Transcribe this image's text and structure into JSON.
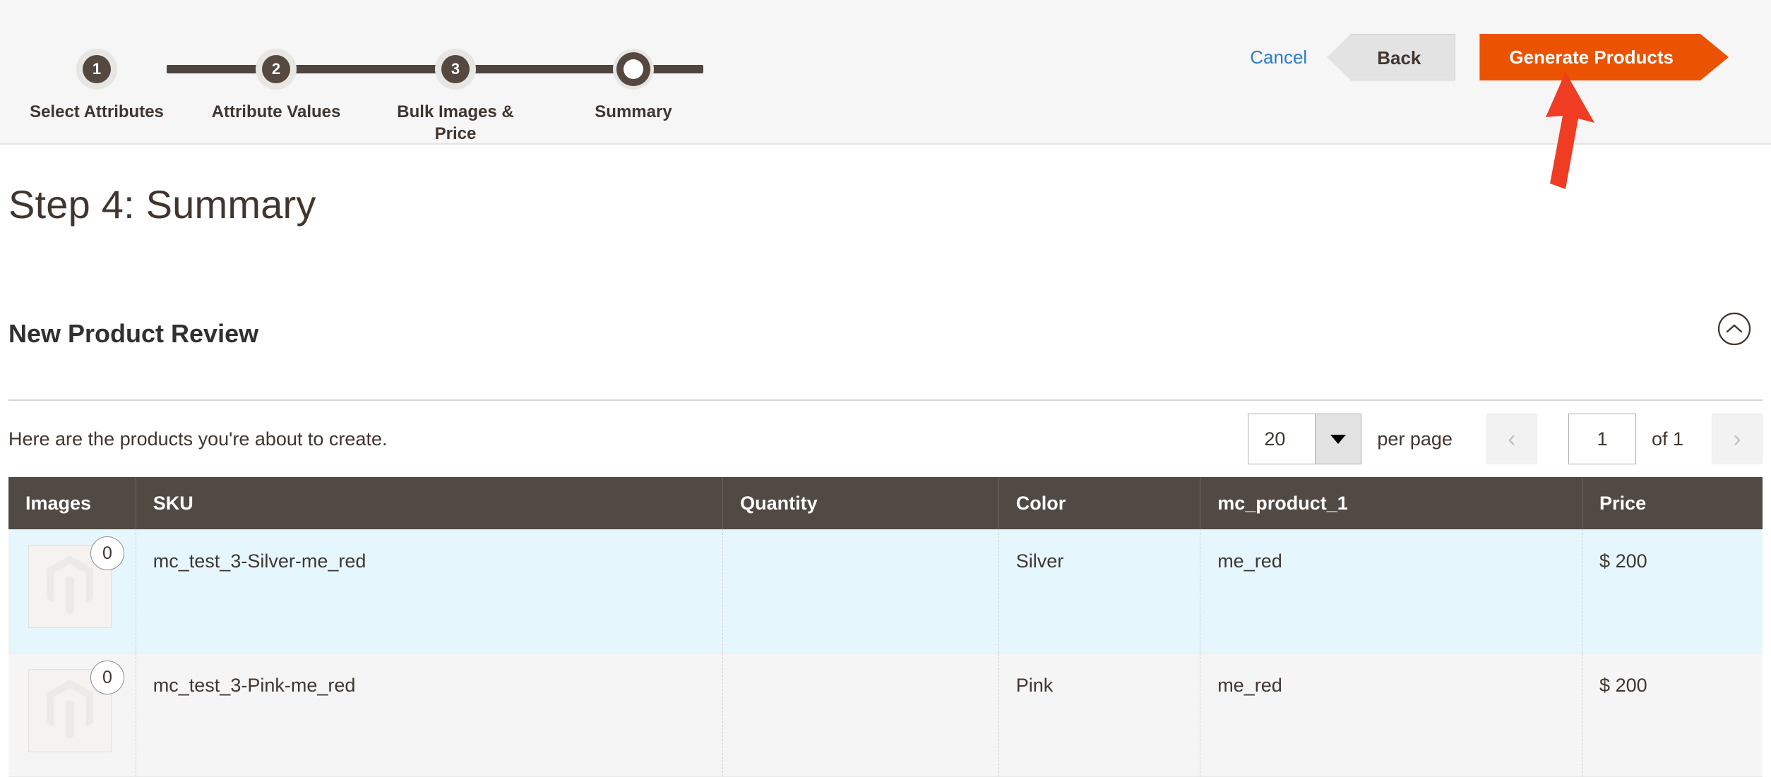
{
  "wizard": {
    "steps": [
      {
        "number": "1",
        "label": "Select Attributes",
        "state": "done"
      },
      {
        "number": "2",
        "label": "Attribute Values",
        "state": "done"
      },
      {
        "number": "3",
        "label": "Bulk Images & Price",
        "state": "done"
      },
      {
        "number": "4",
        "label": "Summary",
        "state": "current"
      }
    ],
    "cancel_label": "Cancel",
    "back_label": "Back",
    "generate_label": "Generate Products",
    "accent_color": "#eb5202",
    "link_color": "#2a7cc7",
    "track_color": "#4d453e"
  },
  "page": {
    "title": "Step 4: Summary"
  },
  "section": {
    "title": "New Product Review",
    "collapse_icon": "chevron-up-circle-icon"
  },
  "toolbar": {
    "note": "Here are the products you're about to create.",
    "limit_value": "20",
    "per_page_label": "per page",
    "page_value": "1",
    "of_total": "of 1",
    "prev_icon": "chevron-left-icon",
    "next_icon": "chevron-right-icon",
    "dropdown_icon": "caret-down-icon"
  },
  "table": {
    "columns": [
      "Images",
      "SKU",
      "Quantity",
      "Color",
      "mc_product_1",
      "Price"
    ],
    "rows": [
      {
        "image_count": "0",
        "sku": "mc_test_3-Silver-me_red",
        "quantity": "",
        "color": "Silver",
        "mc_product_1": "me_red",
        "price": "$ 200"
      },
      {
        "image_count": "0",
        "sku": "mc_test_3-Pink-me_red",
        "quantity": "",
        "color": "Pink",
        "mc_product_1": "me_red",
        "price": "$ 200"
      }
    ]
  },
  "annotation": {
    "arrow_color": "#f03c22",
    "points_to": "Generate Products"
  }
}
